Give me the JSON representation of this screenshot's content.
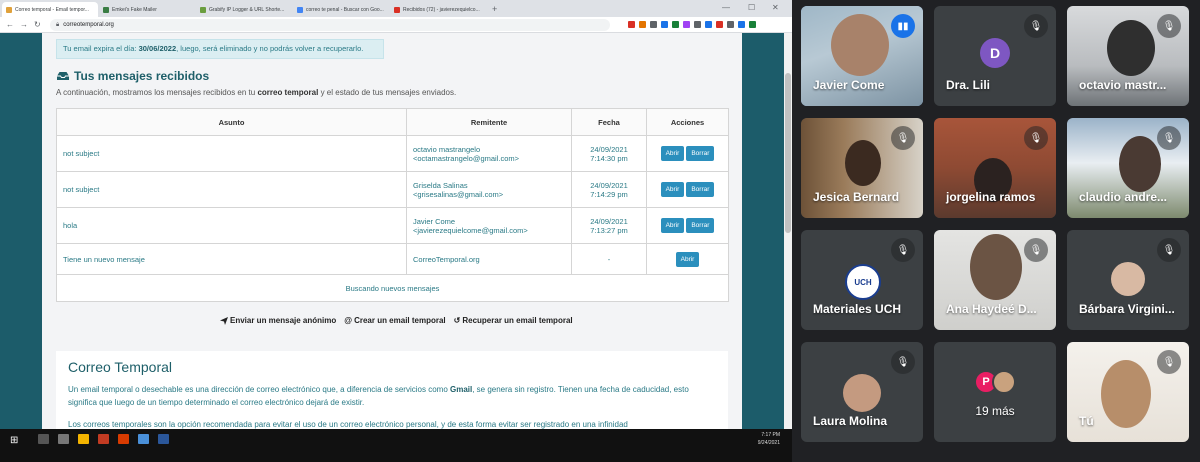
{
  "browser": {
    "tabs": [
      {
        "label": "Correo temporal - Email tempor...",
        "color": "#e0a13b"
      },
      {
        "label": "Emkei's Fake Mailer",
        "color": "#3a7d44"
      },
      {
        "label": "Grabify IP Logger & URL Shorte...",
        "color": "#6b9e3f"
      },
      {
        "label": "correo te penal - Buscar con Goo...",
        "color": "#4285f4"
      },
      {
        "label": "Recibidos (72) - javierezequielco...",
        "color": "#d93025"
      }
    ],
    "new_tab": "+",
    "url": "correotemporal.org",
    "ext_colors": [
      "#d93025",
      "#e37400",
      "#5f6368",
      "#1a73e8",
      "#188038",
      "#a142f4",
      "#5f6368",
      "#1a73e8",
      "#d93025",
      "#5f6368",
      "#1a73e8",
      "#188038"
    ]
  },
  "page": {
    "expiry_prefix": "Tu email expira el día: ",
    "expiry_date": "30/06/2022",
    "expiry_suffix": ", luego, será eliminado y no podrás volver a recuperarlo.",
    "inbox_title": "Tus mensajes recibidos",
    "inbox_desc_pre": "A continuación, mostramos los mensajes recibidos en tu ",
    "inbox_desc_bold": "correo temporal",
    "inbox_desc_post": " y el estado de tus mensajes enviados.",
    "table": {
      "headers": [
        "Asunto",
        "Remitente",
        "Fecha",
        "Acciones"
      ],
      "rows": [
        {
          "subject": "not subject",
          "sender_name": "octavio mastrangelo",
          "sender_email": "<octamastrangelo@gmail.com>",
          "date": "24/09/2021",
          "time": "7:14:30 pm",
          "open": "Abrir",
          "delete": "Borrar"
        },
        {
          "subject": "not subject",
          "sender_name": "Griselda Salinas",
          "sender_email": "<grisesalinas@gmail.com>",
          "date": "24/09/2021",
          "time": "7:14:29 pm",
          "open": "Abrir",
          "delete": "Borrar"
        },
        {
          "subject": "hola",
          "sender_name": "Javier Come",
          "sender_email": "<javierezequielcome@gmail.com>",
          "date": "24/09/2021",
          "time": "7:13:27 pm",
          "open": "Abrir",
          "delete": "Borrar"
        },
        {
          "subject": "Tiene un nuevo mensaje",
          "sender_name": "CorreoTemporal.org",
          "date": "-",
          "open": "Abrir"
        }
      ],
      "status": "Buscando nuevos mensajes"
    },
    "links": [
      {
        "icon": "send-icon",
        "label": "Enviar un mensaje anónimo"
      },
      {
        "icon": "at-icon",
        "label": "Crear un email temporal"
      },
      {
        "icon": "refresh-icon",
        "label": "Recuperar un email temporal"
      }
    ],
    "info_title": "Correo Temporal",
    "info_p1_pre": "Un email temporal o desechable es una dirección de correo electrónico que, a diferencia de servicios como ",
    "info_p1_bold": "Gmail",
    "info_p1_post": ", se genera sin registro. Tienen una fecha de caducidad, esto significa que luego de un tiempo determinado el correo electrónico dejará de existir.",
    "info_p2": "Los correos temporales son la opción recomendada para evitar el uso de un correo electrónico personal, y de esta forma evitar ser registrado en una infinidad"
  },
  "taskbar": {
    "clock_time": "7:17 PM",
    "clock_date": "9/24/2021"
  },
  "meet": {
    "participants": [
      {
        "name": "Javier Come",
        "speaking": true
      },
      {
        "name": "Dra. Lili",
        "initial": "D",
        "avatar_color": "#7e57c2"
      },
      {
        "name": "octavio mastr..."
      },
      {
        "name": "Jesica Bernard"
      },
      {
        "name": "jorgelina ramos"
      },
      {
        "name": "claudio andre..."
      },
      {
        "name": "Materiales UCH",
        "logo_text": "UCH"
      },
      {
        "name": "Ana Haydeé D..."
      },
      {
        "name": "Bárbara Virgini..."
      },
      {
        "name": "Laura Molina"
      },
      {
        "name": "19 más",
        "initial": "P",
        "avatar_color": "#e91e63"
      },
      {
        "name": "Tú"
      }
    ]
  }
}
